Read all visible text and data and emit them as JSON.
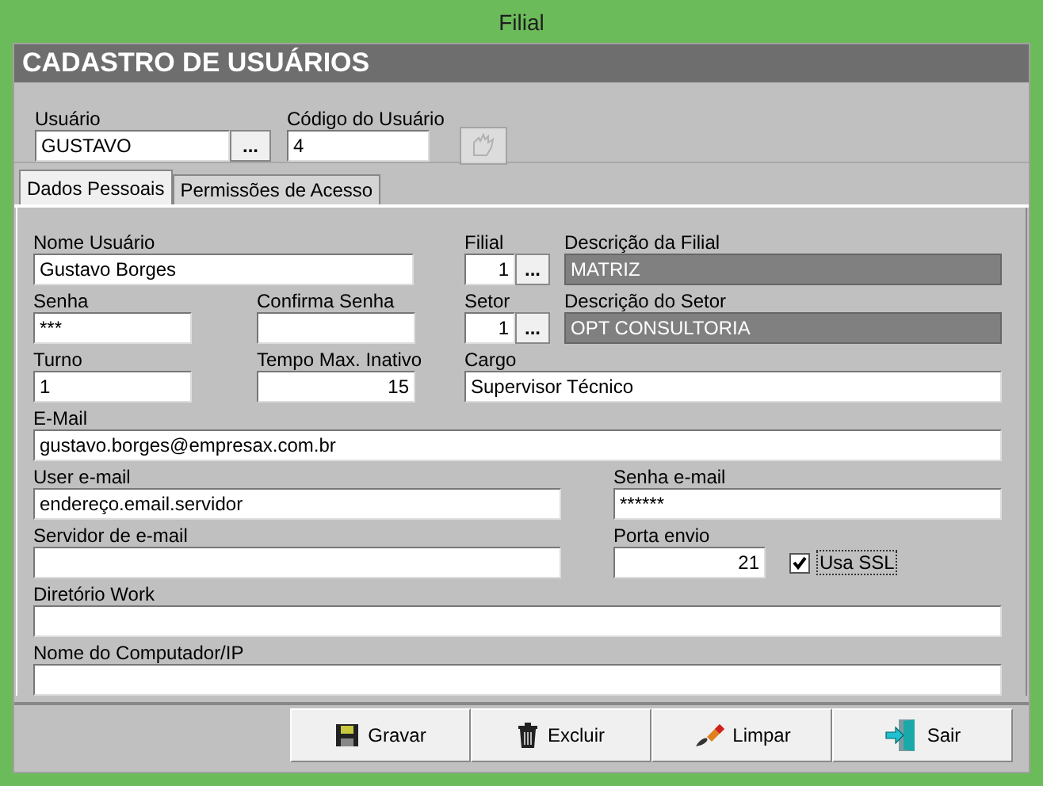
{
  "window": {
    "title": "Filial"
  },
  "header": {
    "title": "CADASTRO DE USUÁRIOS"
  },
  "top_fields": {
    "user": {
      "label": "Usuário",
      "value": "GUSTAVO",
      "button": "..."
    },
    "code": {
      "label": "Código do Usuário",
      "value": "4",
      "disabled": true
    }
  },
  "tabs": [
    {
      "label": "Dados Pessoais",
      "selected": true
    },
    {
      "label": "Permissões de Acesso",
      "selected": false
    }
  ],
  "form_rows": [
    {
      "fields": [
        {
          "kind": "text",
          "label": "Nome Usuário",
          "value": "Gustavo Borges"
        },
        {
          "kind": "lookup",
          "label": "Filial",
          "value": "1",
          "button": "..."
        },
        {
          "kind": "readonly",
          "label": "Descrição da Filial",
          "value": "MATRIZ"
        }
      ]
    },
    {
      "fields": [
        {
          "kind": "text",
          "label": "Senha",
          "value": "***"
        },
        {
          "kind": "text",
          "label": "Confirma Senha"
        },
        {
          "kind": "lookup",
          "label": "Setor",
          "value": "1",
          "button": "..."
        },
        {
          "kind": "readonly",
          "label": "Descrição do Setor",
          "value": "OPT CONSULTORIA"
        }
      ]
    },
    {
      "fields": [
        {
          "kind": "text",
          "label": "Turno",
          "value": "1"
        },
        {
          "kind": "number",
          "label": "Tempo Max. Inativo",
          "value": "15"
        },
        {
          "kind": "text",
          "label": "Cargo",
          "value": "Supervisor Técnico"
        }
      ]
    },
    {
      "fields": [
        {
          "kind": "text",
          "label": "E-Mail",
          "value": "gustavo.borges@empresax.com.br"
        }
      ]
    },
    {
      "fields": [
        {
          "kind": "text",
          "label": "User e-mail",
          "value": "endereço.email.servidor"
        },
        {
          "kind": "text",
          "label": "Senha e-mail",
          "value": "******"
        }
      ]
    },
    {
      "fields": [
        {
          "kind": "text",
          "label": "Servidor de e-mail"
        },
        {
          "kind": "number",
          "label": "Porta envio",
          "value": "21"
        },
        {
          "kind": "checkbox",
          "label": "Usa SSL",
          "checked": true
        }
      ]
    },
    {
      "fields": [
        {
          "kind": "text",
          "label": "Diretório Work"
        }
      ]
    },
    {
      "fields": [
        {
          "kind": "text",
          "label": "Nome do Computador/IP"
        }
      ]
    }
  ],
  "buttons": [
    {
      "kind": "save",
      "label": "Gravar"
    },
    {
      "kind": "delete",
      "label": "Excluir"
    },
    {
      "kind": "clear",
      "label": "Limpar"
    },
    {
      "kind": "exit",
      "label": "Sair"
    }
  ]
}
